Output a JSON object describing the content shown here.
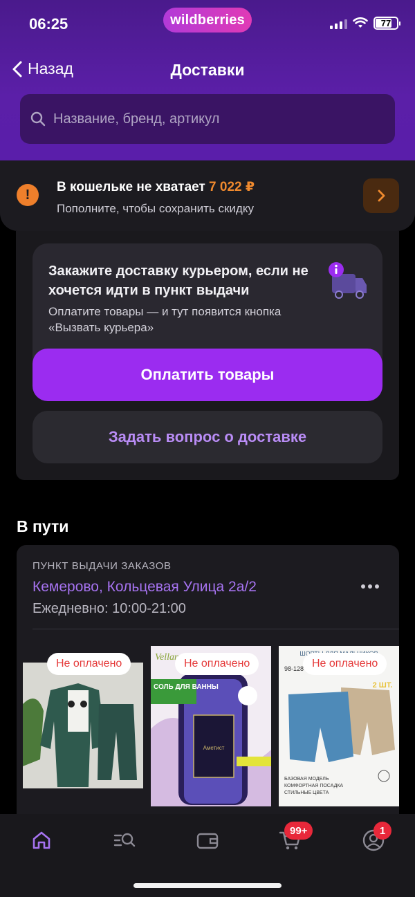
{
  "status_bar": {
    "time": "06:25",
    "battery": "77"
  },
  "brand": {
    "logo_text": "wildberries"
  },
  "nav": {
    "back_label": "Назад",
    "title": "Доставки"
  },
  "search": {
    "placeholder": "Название, бренд, артикул"
  },
  "wallet_alert": {
    "title": "В кошельке не хватает",
    "amount": "7 022 ₽",
    "subtitle": "Пополните, чтобы сохранить скидку"
  },
  "courier_promo": {
    "title": "Закажите доставку курьером, если не хочется идти в пункт выдачи",
    "subtitle": "Оплатите товары — и тут появится кнопка «Вызвать курьера»"
  },
  "buttons": {
    "pay": "Оплатить товары",
    "ask": "Задать вопрос о доставке"
  },
  "in_transit": {
    "section_title": "В пути",
    "pickup_label": "ПУНКТ ВЫДАЧИ ЗАКАЗОВ",
    "address": "Кемерово, Кольцевая Улица 2а/2",
    "hours": "Ежедневно: 10:00-21:00",
    "products": [
      {
        "badge": "Не оплачено"
      },
      {
        "badge": "Не оплачено",
        "image_text": [
          "Vellan",
          "СОЛЬ ДЛЯ ВАННЫ",
          "Аметист"
        ]
      },
      {
        "badge": "Не оплачено",
        "image_text": [
          "ШОРТЫ ДЛЯ МАЛЬЧИКОВ",
          "98-128",
          "2 ШТ.",
          "БАЗОВАЯ МОДЕЛЬ",
          "КОМФОРТНАЯ ПОСАДКА",
          "СТИЛЬНЫЕ ЦВЕТА"
        ]
      }
    ]
  },
  "tabbar": {
    "items": [
      "home-icon",
      "catalog-search-icon",
      "wallet-icon",
      "cart-icon",
      "profile-icon"
    ],
    "cart_badge": "99+",
    "profile_badge": "1"
  },
  "colors": {
    "accent": "#9b2cf0",
    "header": "#5b1fa8",
    "warning": "#f08a2e",
    "badge_red": "#e8283a"
  }
}
